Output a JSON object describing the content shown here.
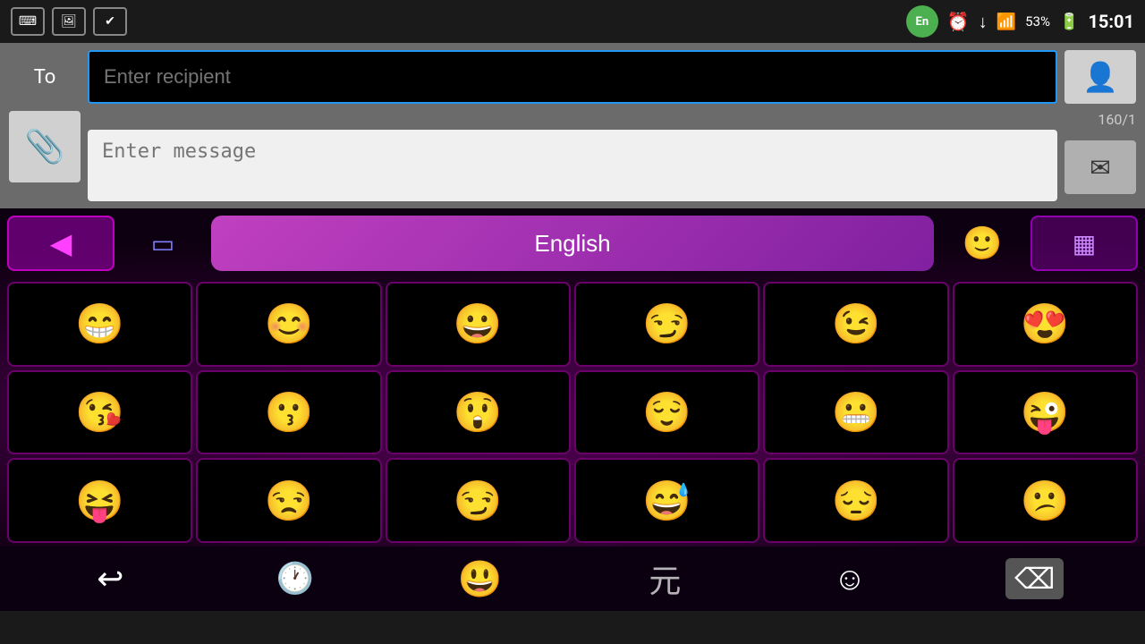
{
  "statusBar": {
    "lang": "En",
    "time": "15:01",
    "battery": "53%",
    "icons": {
      "keyboard": "⌨",
      "image": "🖼",
      "check": "✔"
    }
  },
  "messaging": {
    "toLabel": "To",
    "recipientPlaceholder": "Enter recipient",
    "messagePlaceholder": "Enter message",
    "charCount": "160/1"
  },
  "keyboard": {
    "languageLabel": "English",
    "emojis": [
      "😁",
      "😊",
      "😀",
      "😏",
      "😉",
      "😍",
      "😘",
      "😗",
      "😲",
      "😌",
      "😬",
      "😜",
      "😝",
      "😒",
      "😏",
      "😅",
      "😔",
      "😕"
    ],
    "bottomBar": {
      "back": "↩",
      "history": "🕐",
      "emoji": "😃",
      "kanji": "元",
      "face": "☺",
      "backspace": "⌫"
    }
  }
}
